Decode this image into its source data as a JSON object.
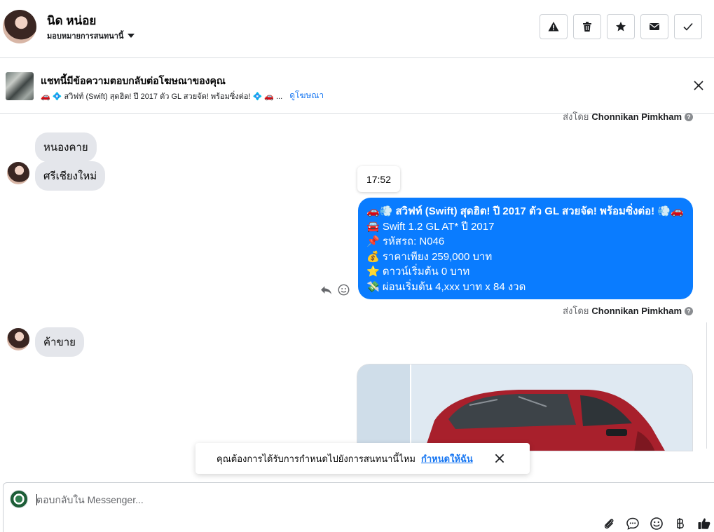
{
  "header": {
    "user_name": "นิด หน่อย",
    "assign_label": "มอบหมายการสนทนานี้",
    "icons": [
      "warning-icon",
      "trash-icon",
      "star-icon",
      "envelope-icon",
      "check-icon"
    ]
  },
  "ad_banner": {
    "title": "แชทนี้มีข้อความตอบกลับต่อโฆษณาของคุณ",
    "snippet": "🚗 💠 สวิฟท์ (Swift) สุดฮิต! ปี 2017 ตัว GL สวยจัด! พร้อมซิ่งต่อ! 💠 🚗 ...",
    "link": "ดูโฆษณา"
  },
  "messages": {
    "sent_by_label": "ส่งโดย",
    "sent_by_name": "Chonnikan Pimkham",
    "incoming_1": "หนองคาย",
    "incoming_2": "ศรีเชียงใหม่",
    "incoming_3": "ค้าขาย",
    "time": "17:52",
    "outgoing_lines": [
      "🚗💨 สวิฟท์ (Swift) สุดฮิต! ปี 2017 ตัว GL สวยจัด! พร้อมซิ่งต่อ! 💨🚗",
      "🚘 Swift 1.2 GL AT* ปี 2017",
      "📌 รหัสรถ: N046",
      "💰 ราคาเพียง 259,000 บาท",
      "⭐ ดาวน์เริ่มต้น 0 บาท",
      "💸 ผ่อนเริ่มต้น 4,xxx บาท x 84 งวด"
    ]
  },
  "toast": {
    "text": "คุณต้องการได้รับการกำหนดไปยังการสนทนานี้ไหม",
    "link": "กำหนดให้ฉัน"
  },
  "composer": {
    "placeholder": "ตอบกลับใน Messenger...",
    "tools": [
      "paperclip-icon",
      "chat-bubble-icon",
      "emoji-icon",
      "baht-icon",
      "thumbs-up-icon"
    ]
  },
  "colors": {
    "accent": "#1877f2",
    "outgoing_bubble": "#0a7cff",
    "incoming_bubble": "#e4e6eb"
  }
}
